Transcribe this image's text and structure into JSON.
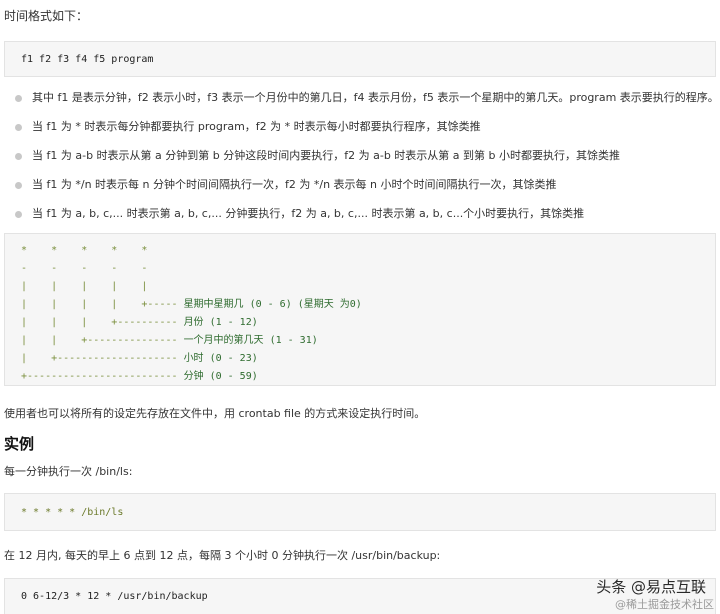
{
  "intro": "时间格式如下：",
  "format_code": "f1 f2 f3 f4 f5 program",
  "bullets": [
    "其中 f1 是表示分钟，f2 表示小时，f3 表示一个月份中的第几日，f4 表示月份，f5 表示一个星期中的第几天。program 表示要执行的程序。",
    "当 f1 为 * 时表示每分钟都要执行 program，f2 为 * 时表示每小时都要执行程序，其馀类推",
    "当 f1 为 a-b 时表示从第 a 分钟到第 b 分钟这段时间内要执行，f2 为 a-b 时表示从第 a 到第 b 小时都要执行，其馀类推",
    "当 f1 为 */n 时表示每 n 分钟个时间间隔执行一次，f2 为 */n 表示每 n 小时个时间间隔执行一次，其馀类推",
    "当 f1 为 a, b, c,... 时表示第 a, b, c,... 分钟要执行，f2 为 a, b, c,... 时表示第 a, b, c...个小时要执行，其馀类推"
  ],
  "tree": [
    {
      "text": "*    *    *    *    *",
      "label": ""
    },
    {
      "text": "-    -    -    -    -",
      "label": ""
    },
    {
      "text": "|    |    |    |    |",
      "label": ""
    },
    {
      "text": "|    |    |    |    +----- ",
      "label": "星期中星期几 (0 - 6) (星期天 为0)"
    },
    {
      "text": "|    |    |    +---------- ",
      "label": "月份 (1 - 12)"
    },
    {
      "text": "|    |    +--------------- ",
      "label": "一个月中的第几天 (1 - 31)"
    },
    {
      "text": "|    +-------------------- ",
      "label": "小时 (0 - 23)"
    },
    {
      "text": "+------------------------- ",
      "label": "分钟 (0 - 59)"
    }
  ],
  "crontab_note": "使用者也可以将所有的设定先存放在文件中，用 crontab file 的方式来设定执行时间。",
  "example_heading": "实例",
  "example1_desc": "每一分钟执行一次 /bin/ls:",
  "example1_code": "* * * * * /bin/ls",
  "example2_desc": "在 12 月内, 每天的早上 6 点到 12 点，每隔 3 个小时 0 分钟执行一次 /usr/bin/backup:",
  "example2_code": "0 6-12/3 * 12 * /usr/bin/backup",
  "watermark": "头条 @易点互联",
  "watermark_sub": "@稀土掘金技术社区"
}
